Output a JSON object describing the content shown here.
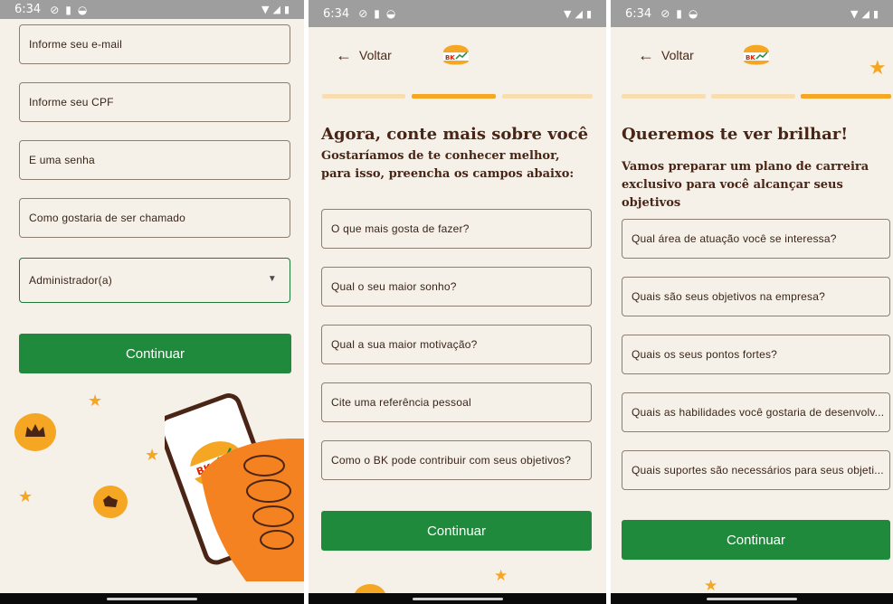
{
  "status": {
    "time": "6:34"
  },
  "screen1": {
    "fields": [
      "Informe seu e-mail",
      "Informe seu CPF",
      "E uma senha",
      "Como gostaria de ser chamado"
    ],
    "select_value": "Administrador(a)",
    "button": "Continuar",
    "illustration_logo_text": "BK FUTURE"
  },
  "screen2": {
    "back": "Voltar",
    "title": "Agora, conte mais sobre você",
    "subtitle": "Gostaríamos de te conhecer melhor, para isso, preencha os campos abaixo:",
    "fields": [
      "O que mais gosta de fazer?",
      "Qual o seu maior sonho?",
      "Qual a sua maior motivação?",
      "Cite uma referência pessoal",
      "Como o BK pode contribuir com seus objetivos?"
    ],
    "button": "Continuar",
    "progress_step": 2,
    "progress_total": 3
  },
  "screen3": {
    "back": "Voltar",
    "title": "Queremos te ver brilhar!",
    "subtitle": "Vamos preparar um plano de carreira exclusivo para você alcançar seus objetivos",
    "fields": [
      "Qual área de atuação você se interessa?",
      "Quais são seus objetivos na empresa?",
      "Quais os seus pontos fortes?",
      "Quais as habilidades você gostaria de desenvolv...",
      "Quais suportes são necessários para seus objeti..."
    ],
    "button": "Continuar",
    "progress_step": 3,
    "progress_total": 3
  },
  "brand": {
    "logo_text": "BK FUTURE",
    "green": "#1f8a3c",
    "orange": "#f5a623",
    "brown": "#4a2515",
    "background": "#f5f1e9"
  }
}
